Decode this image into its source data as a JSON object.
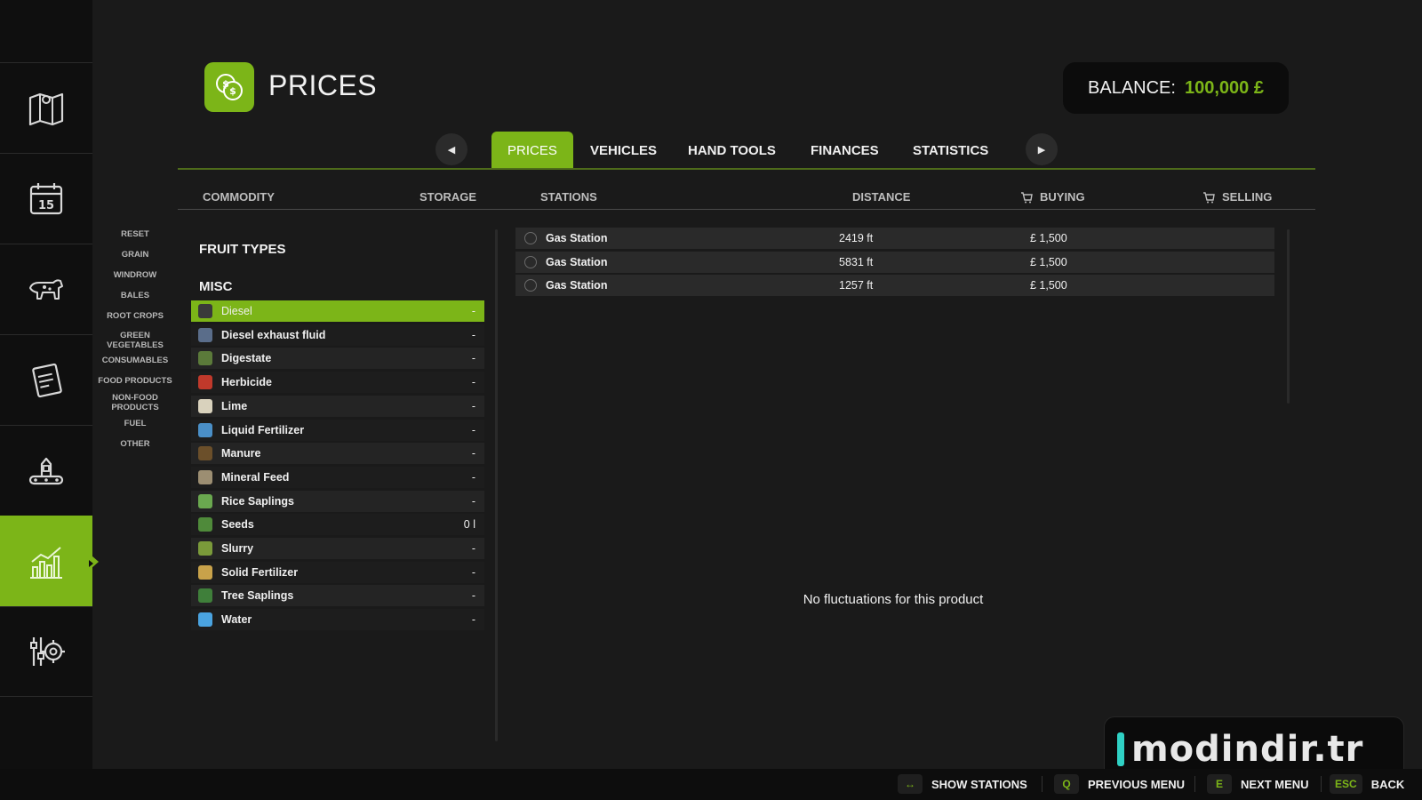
{
  "header": {
    "title": "PRICES",
    "balance_label": "BALANCE:",
    "balance_value": "100,000 £"
  },
  "tabs": [
    {
      "label": "PRICES",
      "active": true
    },
    {
      "label": "VEHICLES"
    },
    {
      "label": "HAND TOOLS"
    },
    {
      "label": "FINANCES"
    },
    {
      "label": "STATISTICS"
    }
  ],
  "columns": {
    "commodity": "COMMODITY",
    "storage": "STORAGE",
    "stations": "STATIONS",
    "distance": "DISTANCE",
    "buying": "BUYING",
    "selling": "SELLING"
  },
  "sidebar_nav": [
    {
      "icon": "map-icon"
    },
    {
      "icon": "calendar-icon"
    },
    {
      "icon": "animals-icon"
    },
    {
      "icon": "contracts-icon"
    },
    {
      "icon": "production-icon"
    },
    {
      "icon": "prices-chart-icon",
      "active": true
    },
    {
      "icon": "settings-icon"
    }
  ],
  "filters": [
    "RESET",
    "GRAIN",
    "WINDROW",
    "BALES",
    "ROOT CROPS",
    "GREEN VEGETABLES",
    "CONSUMABLES",
    "FOOD PRODUCTS",
    "NON-FOOD PRODUCTS",
    "FUEL",
    "OTHER"
  ],
  "sections": {
    "fruit_types": "FRUIT TYPES",
    "misc": "MISC"
  },
  "commodities": [
    {
      "name": "Diesel",
      "storage": "-",
      "selected": true,
      "icon": "diesel-icon",
      "color": "#3a3a3a"
    },
    {
      "name": "Diesel exhaust fluid",
      "storage": "-",
      "icon": "def-icon",
      "color": "#5a6d8a"
    },
    {
      "name": "Digestate",
      "storage": "-",
      "icon": "digestate-icon",
      "color": "#5b7a3a"
    },
    {
      "name": "Herbicide",
      "storage": "-",
      "icon": "herbicide-icon",
      "color": "#c0392b"
    },
    {
      "name": "Lime",
      "storage": "-",
      "icon": "lime-icon",
      "color": "#d9d2bd"
    },
    {
      "name": "Liquid Fertilizer",
      "storage": "-",
      "icon": "liquid-fertilizer-icon",
      "color": "#4a8fc7"
    },
    {
      "name": "Manure",
      "storage": "-",
      "icon": "manure-icon",
      "color": "#6b4f2a"
    },
    {
      "name": "Mineral Feed",
      "storage": "-",
      "icon": "mineral-feed-icon",
      "color": "#9c8e72"
    },
    {
      "name": "Rice Saplings",
      "storage": "-",
      "icon": "rice-saplings-icon",
      "color": "#6aa84f"
    },
    {
      "name": "Seeds",
      "storage": "0 l",
      "icon": "seeds-icon",
      "color": "#4f8a3a"
    },
    {
      "name": "Slurry",
      "storage": "-",
      "icon": "slurry-icon",
      "color": "#7a9a3a"
    },
    {
      "name": "Solid Fertilizer",
      "storage": "-",
      "icon": "solid-fertilizer-icon",
      "color": "#c8a24a"
    },
    {
      "name": "Tree Saplings",
      "storage": "-",
      "icon": "tree-saplings-icon",
      "color": "#3f7f3a"
    },
    {
      "name": "Water",
      "storage": "-",
      "icon": "water-icon",
      "color": "#4aa3e0"
    }
  ],
  "stations": [
    {
      "name": "Gas Station",
      "distance": "2419 ft",
      "buying": "£ 1,500"
    },
    {
      "name": "Gas Station",
      "distance": "5831 ft",
      "buying": "£ 1,500"
    },
    {
      "name": "Gas Station",
      "distance": "1257 ft",
      "buying": "£ 1,500"
    }
  ],
  "empty_message": "No fluctuations for this product",
  "footer_hints": [
    {
      "key": "↔",
      "label": "SHOW STATIONS"
    },
    {
      "key": "Q",
      "label": "PREVIOUS MENU"
    },
    {
      "key": "E",
      "label": "NEXT MENU"
    },
    {
      "key": "ESC",
      "label": "BACK"
    }
  ],
  "watermark": "modindir.tr",
  "colors": {
    "accent": "#7cb518",
    "background": "#1a1a1a"
  }
}
